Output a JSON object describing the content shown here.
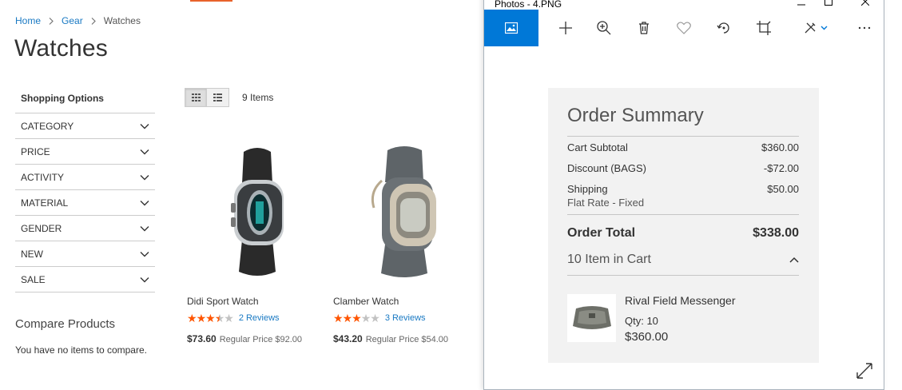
{
  "breadcrumb": {
    "home": "Home",
    "gear": "Gear",
    "current": "Watches"
  },
  "page_title": "Watches",
  "shopping_options": {
    "heading": "Shopping Options",
    "filters": [
      "CATEGORY",
      "PRICE",
      "ACTIVITY",
      "MATERIAL",
      "GENDER",
      "NEW",
      "SALE"
    ]
  },
  "toolbar": {
    "items_count": "9 Items"
  },
  "products": [
    {
      "name": "Didi Sport Watch",
      "rating": 3.5,
      "reviews": "2 Reviews",
      "final_price": "$73.60",
      "regular_price": "Regular Price $92.00"
    },
    {
      "name": "Clamber Watch",
      "rating": 3,
      "reviews": "3 Reviews",
      "final_price": "$43.20",
      "regular_price": "Regular Price $54.00"
    }
  ],
  "compare": {
    "title": "Compare Products",
    "empty": "You have no items to compare."
  },
  "photos_window": {
    "title": "Photos - 4.PNG",
    "accent": "#0078d7",
    "order_summary": {
      "title": "Order Summary",
      "subtotal_label": "Cart Subtotal",
      "subtotal_value": "$360.00",
      "discount_label": "Discount (BAGS)",
      "discount_value": "-$72.00",
      "shipping_label": "Shipping",
      "shipping_method": "Flat Rate - Fixed",
      "shipping_value": "$50.00",
      "total_label": "Order Total",
      "total_value": "$338.00",
      "cart_label": "10 Item in Cart",
      "item": {
        "name": "Rival Field Messenger",
        "qty": "Qty: 10",
        "price": "$360.00"
      }
    }
  },
  "colors": {
    "link": "#1979c3",
    "star": "#ff5501",
    "accent_bar": "#e8622b"
  }
}
